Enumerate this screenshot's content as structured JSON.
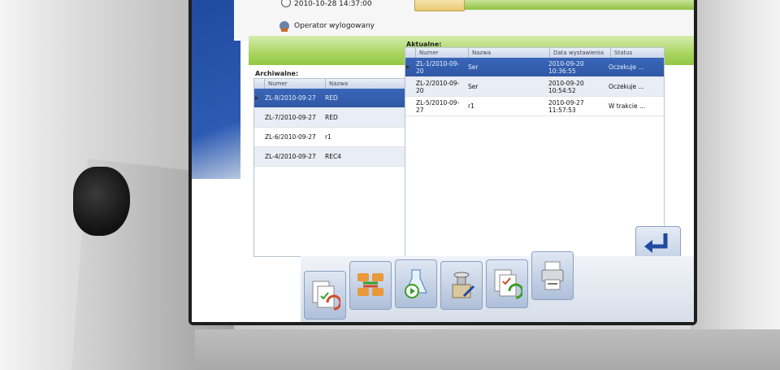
{
  "header": {
    "datetime": "2010-10-28 14:37:00",
    "operator_status": "Operator wylogowany"
  },
  "archived": {
    "label": "Archiwalne:",
    "columns": [
      "Numer",
      "Nazwa"
    ],
    "rows": [
      {
        "numer": "ZL-8/2010-09-27",
        "nazwa": "RED",
        "selected": true
      },
      {
        "numer": "ZL-7/2010-09-27",
        "nazwa": "RED",
        "selected": false
      },
      {
        "numer": "ZL-6/2010-09-27",
        "nazwa": "r1",
        "selected": false
      },
      {
        "numer": "ZL-4/2010-09-27",
        "nazwa": "REC4",
        "selected": false
      }
    ]
  },
  "current": {
    "label": "Aktualne:",
    "columns": [
      "Numer",
      "Nazwa",
      "Data wystawienia",
      "Status"
    ],
    "rows": [
      {
        "numer": "ZL-1/2010-09-20",
        "nazwa": "Ser",
        "data": "2010-09-20 10:36:55",
        "status": "Oczekuje ...",
        "selected": true
      },
      {
        "numer": "ZL-2/2010-09-20",
        "nazwa": "Ser",
        "data": "2010-09-20 10:54:52",
        "status": "Oczekuje ...",
        "selected": false
      },
      {
        "numer": "ZL-5/2010-09-27",
        "nazwa": "r1",
        "data": "2010-09-27 11:57:53",
        "status": "W trakcie ...",
        "selected": false
      }
    ]
  },
  "toolbar": {
    "buttons": [
      "documents-icon",
      "exchange-icon",
      "flask-icon",
      "scale-icon",
      "report-icon",
      "printer-icon"
    ]
  },
  "exit": {
    "icon": "exit-icon"
  },
  "colors": {
    "selection": "#2f58a6",
    "green": "#93c743",
    "brand_blue": "#1f4aa0"
  }
}
